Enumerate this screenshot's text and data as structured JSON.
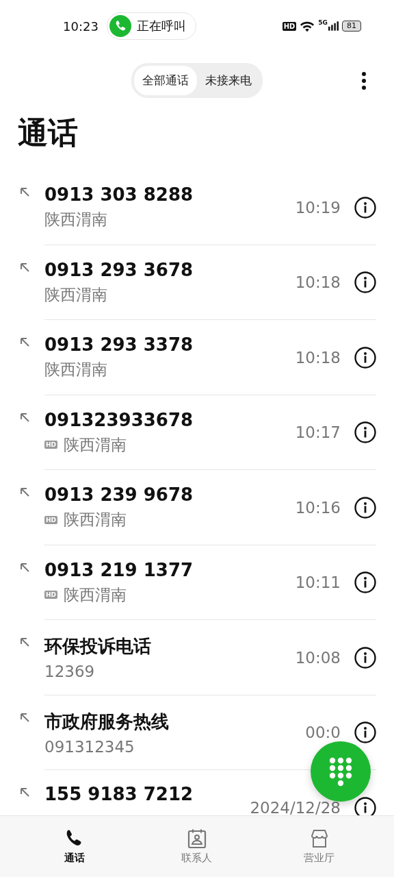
{
  "status_bar": {
    "time": "10:23",
    "call_pill": "正在呼叫",
    "network_badge": "HD",
    "signal_label": "5G",
    "battery": "81"
  },
  "tabs": [
    {
      "label": "全部通话",
      "selected": true
    },
    {
      "label": "未接来电",
      "selected": false
    }
  ],
  "title": "通话",
  "calls": [
    {
      "name": "0913 303 8288",
      "detail": "陕西渭南",
      "time": "10:19"
    },
    {
      "name": "0913 293 3678",
      "detail": "陕西渭南",
      "time": "10:18"
    },
    {
      "name": "0913 293 3378",
      "detail": "陕西渭南",
      "time": "10:18"
    },
    {
      "name": "091323933678",
      "badge": "HD",
      "detail": "陕西渭南",
      "time": "10:17"
    },
    {
      "name": "0913 239 9678",
      "badge": "HD",
      "detail": "陕西渭南",
      "time": "10:16"
    },
    {
      "name": "0913 219 1377",
      "badge": "HD",
      "detail": "陕西渭南",
      "time": "10:11"
    },
    {
      "name": "环保投诉电话",
      "detail": "12369",
      "time": "10:08"
    },
    {
      "name": "市政府服务热线",
      "detail": "091312345",
      "time": "00:0"
    },
    {
      "name": "155 9183 7212",
      "time": "2024/12/28"
    }
  ],
  "bottom_nav": [
    {
      "label": "通话",
      "kind": "phone",
      "selected": true
    },
    {
      "label": "联系人",
      "kind": "contacts",
      "selected": false
    },
    {
      "label": "营业厅",
      "kind": "store",
      "selected": false
    }
  ]
}
